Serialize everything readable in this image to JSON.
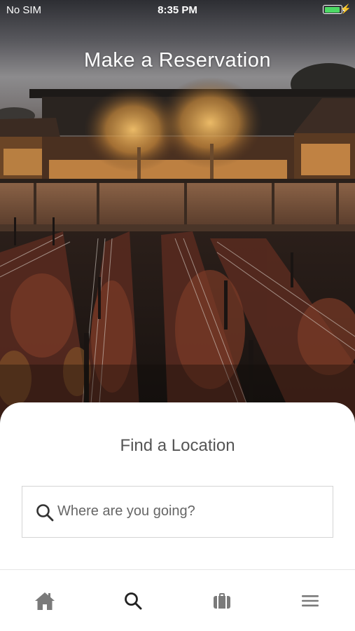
{
  "status_bar": {
    "carrier": "No SIM",
    "time": "8:35 PM",
    "battery_color": "#4cd964",
    "charging_icon": "bolt-icon"
  },
  "hero": {
    "title": "Make a Reservation",
    "image": "vineyard-resort-at-dusk"
  },
  "search_panel": {
    "title": "Find a Location",
    "search": {
      "placeholder": "Where are you going?",
      "value": "",
      "icon": "search-icon"
    }
  },
  "tab_bar": {
    "items": [
      {
        "name": "home",
        "icon": "home-icon"
      },
      {
        "name": "search",
        "icon": "search-icon",
        "active": true
      },
      {
        "name": "trips",
        "icon": "briefcase-icon"
      },
      {
        "name": "menu",
        "icon": "hamburger-icon"
      }
    ],
    "active_color": "#222222",
    "inactive_color": "#7a7a7a"
  }
}
